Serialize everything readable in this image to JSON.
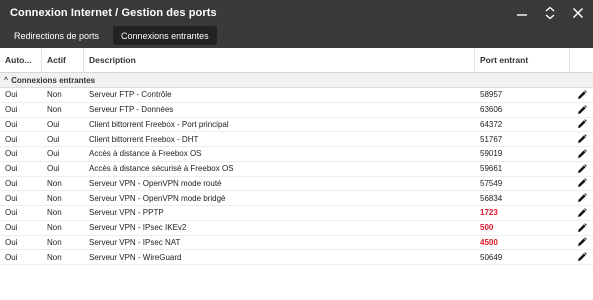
{
  "window": {
    "title": "Connexion Internet / Gestion des ports",
    "controls": [
      "minimize-icon",
      "expand-icon",
      "close-icon"
    ]
  },
  "tabs": [
    {
      "label": "Redirections de ports",
      "active": false
    },
    {
      "label": "Connexions entrantes",
      "active": true
    }
  ],
  "table": {
    "headers": {
      "auto": "Auto...",
      "actif": "Actif",
      "description": "Description",
      "port": "Port entrant"
    },
    "group_label": "Connexions entrantes",
    "warning_color": "#e0182d",
    "rows": [
      {
        "auto": "Oui",
        "actif": "Non",
        "description": "Serveur FTP - Contrôle",
        "port": "58957",
        "warning": false
      },
      {
        "auto": "Oui",
        "actif": "Non",
        "description": "Serveur FTP - Données",
        "port": "63606",
        "warning": false
      },
      {
        "auto": "Oui",
        "actif": "Oui",
        "description": "Client bittorrent Freebox - Port principal",
        "port": "64372",
        "warning": false
      },
      {
        "auto": "Oui",
        "actif": "Oui",
        "description": "Client bittorrent Freebox - DHT",
        "port": "51767",
        "warning": false
      },
      {
        "auto": "Oui",
        "actif": "Oui",
        "description": "Accès à distance à Freebox OS",
        "port": "59019",
        "warning": false
      },
      {
        "auto": "Oui",
        "actif": "Oui",
        "description": "Accès à distance sécurisé à Freebox OS",
        "port": "59661",
        "warning": false
      },
      {
        "auto": "Oui",
        "actif": "Non",
        "description": "Serveur VPN - OpenVPN mode routé",
        "port": "57549",
        "warning": false
      },
      {
        "auto": "Oui",
        "actif": "Non",
        "description": "Serveur VPN - OpenVPN mode bridgé",
        "port": "56834",
        "warning": false
      },
      {
        "auto": "Oui",
        "actif": "Non",
        "description": "Serveur VPN - PPTP",
        "port": "1723",
        "warning": true
      },
      {
        "auto": "Oui",
        "actif": "Non",
        "description": "Serveur VPN - IPsec IKEv2",
        "port": "500",
        "warning": true
      },
      {
        "auto": "Oui",
        "actif": "Non",
        "description": "Serveur VPN - IPsec NAT",
        "port": "4500",
        "warning": true
      },
      {
        "auto": "Oui",
        "actif": "Non",
        "description": "Serveur VPN - WireGuard",
        "port": "50649",
        "warning": false
      }
    ]
  }
}
